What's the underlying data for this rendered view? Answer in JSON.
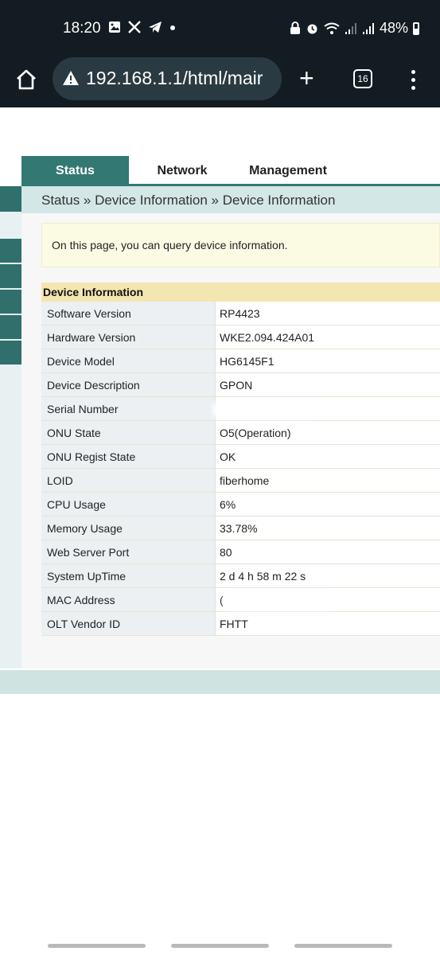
{
  "statusbar": {
    "time": "18:20",
    "battery": "48%",
    "left_icons": [
      "gallery-icon",
      "x-icon",
      "telegram-icon",
      "dot-icon"
    ],
    "right_icons": [
      "lock-icon",
      "alarm-icon",
      "wifi-icon",
      "signal-icon",
      "signal-icon",
      "battery-icon"
    ]
  },
  "browser": {
    "url": "192.168.1.1/html/mair",
    "tab_count": "16"
  },
  "nav": {
    "tabs": [
      {
        "label": "Status",
        "active": true
      },
      {
        "label": "Network",
        "active": false
      },
      {
        "label": "Management",
        "active": false
      }
    ]
  },
  "breadcrumb": "Status » Device Information » Device Information",
  "notice": "On this page, you can query device information.",
  "device_info": {
    "title": "Device Information",
    "rows": [
      {
        "label": "Software Version",
        "value": "RP4423"
      },
      {
        "label": "Hardware Version",
        "value": "WKE2.094.424A01"
      },
      {
        "label": "Device Model",
        "value": "HG6145F1"
      },
      {
        "label": "Device Description",
        "value": "GPON"
      },
      {
        "label": "Serial Number",
        "value": ""
      },
      {
        "label": "ONU State",
        "value": "O5(Operation)"
      },
      {
        "label": "ONU Regist State",
        "value": "OK"
      },
      {
        "label": "LOID",
        "value": "fiberhome"
      },
      {
        "label": "CPU Usage",
        "value": "6%"
      },
      {
        "label": "Memory Usage",
        "value": "33.78%"
      },
      {
        "label": "Web Server Port",
        "value": "80"
      },
      {
        "label": "System UpTime",
        "value": "2 d 4 h 58 m 22 s"
      },
      {
        "label": "MAC Address",
        "value": "("
      },
      {
        "label": "OLT Vendor ID",
        "value": "FHTT"
      }
    ]
  }
}
